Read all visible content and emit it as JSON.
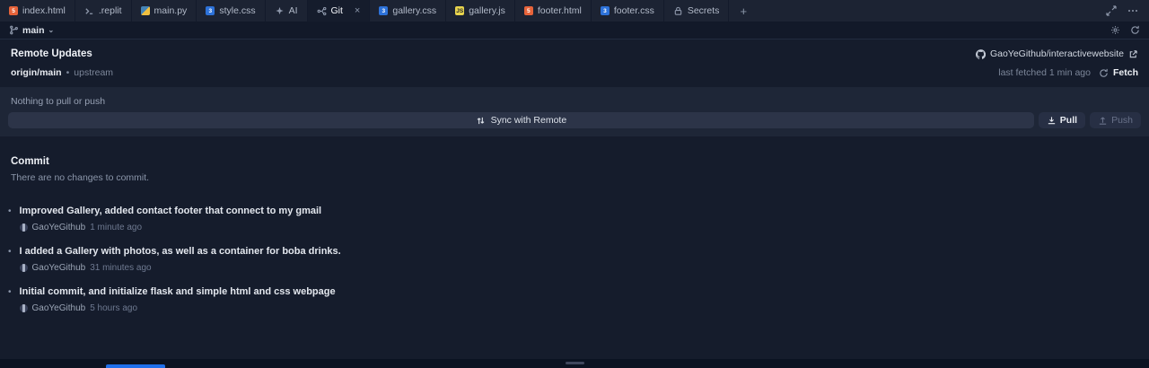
{
  "ui": {
    "close_glyph": "×",
    "plus_glyph": "+",
    "chevron_down": "⌄",
    "bullet": "•",
    "dot": "•"
  },
  "colors": {
    "accent_blue": "#1f6feb",
    "html_icon": "#e6633a",
    "css_icon": "#2d72d9",
    "js_icon": "#e8d44d",
    "panel_bg": "#1e2637",
    "surface_bg": "#1c2333"
  },
  "tabs": {
    "items": [
      {
        "label": "index.html"
      },
      {
        "label": ".replit"
      },
      {
        "label": "main.py"
      },
      {
        "label": "style.css"
      },
      {
        "label": "AI"
      },
      {
        "label": "Git"
      },
      {
        "label": "gallery.css"
      },
      {
        "label": "gallery.js"
      },
      {
        "label": "footer.html"
      },
      {
        "label": "footer.css"
      },
      {
        "label": "Secrets"
      }
    ]
  },
  "toolbar": {
    "branch": "main"
  },
  "remote": {
    "title": "Remote Updates",
    "repo": "GaoYeGithub/interactivewebsite",
    "origin_branch": "origin/main",
    "upstream_label": "upstream",
    "last_fetched": "last fetched 1 min ago",
    "fetch_label": "Fetch",
    "status": "Nothing to pull or push",
    "sync_label": "Sync with Remote",
    "pull_label": "Pull",
    "push_label": "Push"
  },
  "commit_section": {
    "title": "Commit",
    "empty_message": "There are no changes to commit."
  },
  "history": [
    {
      "message": "Improved Gallery, added contact footer that connect to my gmail",
      "author": "GaoYeGithub",
      "time": "1 minute ago"
    },
    {
      "message": "I added a Gallery with photos, as well as a container for boba drinks.",
      "author": "GaoYeGithub",
      "time": "31 minutes ago"
    },
    {
      "message": "Initial commit, and initialize flask and simple html and css webpage",
      "author": "GaoYeGithub",
      "time": "5 hours ago"
    }
  ]
}
